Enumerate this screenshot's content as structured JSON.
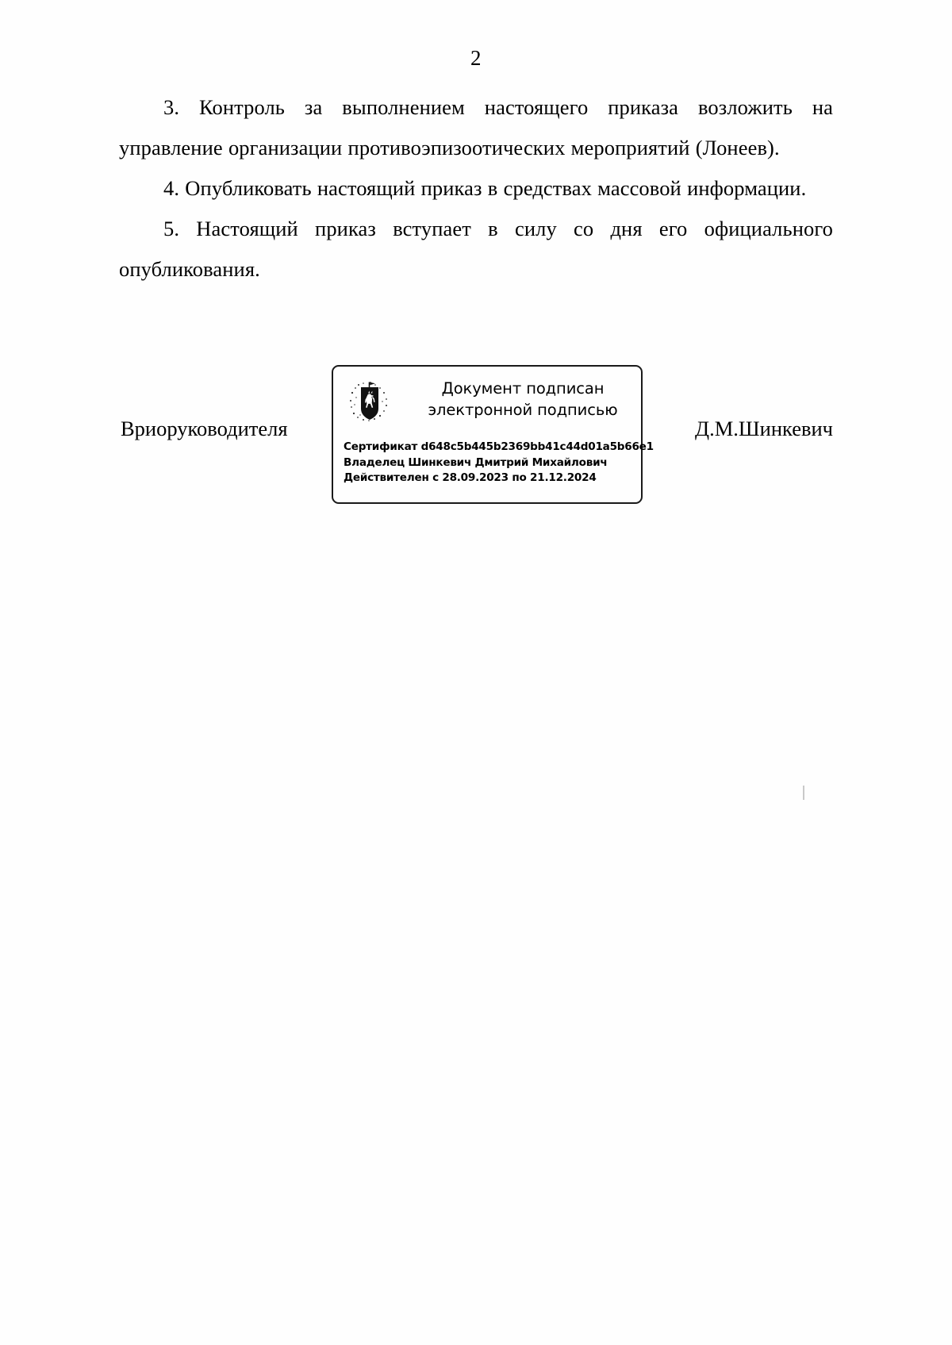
{
  "document": {
    "page_number": "2",
    "paragraphs": [
      "3. Контроль за выполнением настоящего приказа возложить на управление организации противоэпизоотических мероприятий (Лонеев).",
      "4. Опубликовать настоящий приказ в средствах массовой информации.",
      "5. Настоящий приказ вступает в силу со дня его официального опубликования."
    ],
    "signature": {
      "title": "Вриоруководителя",
      "name": "Д.М.Шинкевич"
    },
    "stamp": {
      "emblem_name": "coat-of-arms-emblem",
      "heading_line1": "Документ подписан",
      "heading_line2": "электронной подписью",
      "certificate": "Сертификат d648c5b445b2369bb41c44d01a5b66e1",
      "owner": "Владелец Шинкевич Дмитрий Михайлович",
      "validity": "Действителен с 28.09.2023 по 21.12.2024"
    }
  },
  "colors": {
    "ink": "#000000",
    "paper": "#ffffff",
    "stamp_border": "#1a1a1a"
  }
}
